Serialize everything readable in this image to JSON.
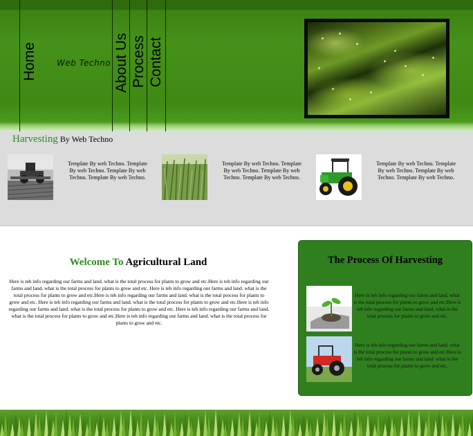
{
  "nav": {
    "items": [
      {
        "label": "Home"
      },
      {
        "label": "About Us"
      },
      {
        "label": "Process"
      },
      {
        "label": "Contact"
      }
    ]
  },
  "brand": {
    "name": "Web Techno"
  },
  "tagline": {
    "accent": "Harvesting",
    "rest": " By Web Techno"
  },
  "features": [
    {
      "image": "farm-machinery-photo",
      "text": "Template By web Techno. Template By web Techno. Template By web Techno. Template By web Techno."
    },
    {
      "image": "crop-field-photo",
      "text": "Template By web Techno. Template By web Techno. Template By web Techno. Template By web Techno."
    },
    {
      "image": "green-tractor-photo",
      "text": "Template By web Techno. Template By web Techno. Template By web Techno. Template By web Techno."
    }
  ],
  "welcome": {
    "title_accent": "Welcome To",
    "title_rest": " Agricultural Land",
    "body": "Here is teh info regarding our farms and land. what is the total process for plants to grow and etc.Here is teh info regarding our farms and land. what is the total process for plants to grow and etc. Here is teh info regarding our farms and land. what is the total process for plants to grow and etc.Here is teh info regarding our farms and land. what is the total process for plants to grow and etc. Here is teh info regarding our farms and land. what is the total process for plants to grow and etc.Here is teh info regarding our farms and land. what is the total process for plants to grow and etc. Here is teh info regarding our farms and land. what is the total process for plants to grow and etc.Here is teh info regarding our farms and land. what is the total process for plants to grow and etc."
  },
  "process": {
    "title": "The Process Of Harvesting",
    "items": [
      {
        "image": "seedling-in-hand-photo",
        "text": "Here is teh info regarding our farms and land. what is the total process for plants to grow and etc.Here is teh info regarding our farms and land. what is the total process for plants to grow and etc."
      },
      {
        "image": "red-tractor-photo",
        "text": "Here is teh info regarding our farms and land. what is the total process for plants to grow and etc.Here is teh info regarding our farms and land. what is the total process for plants to grow and etc."
      }
    ]
  },
  "colors": {
    "header_green": "#45911a",
    "accent_green": "#2e8b1f",
    "process_box": "#2f7f1f",
    "gray_band": "#dcdcdc"
  }
}
